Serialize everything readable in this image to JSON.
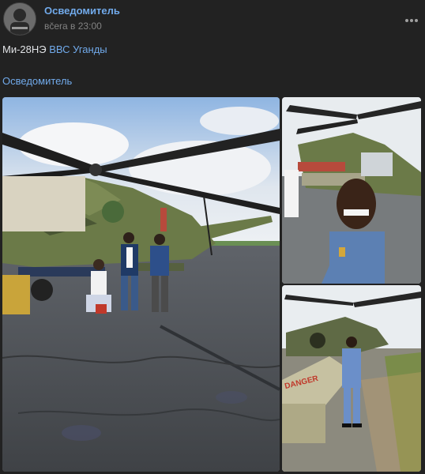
{
  "post": {
    "author": "Осведомитель",
    "time": "вčera в 23:00",
    "text_prefix": "Ми-28НЭ",
    "text_link": "ВВС Уганды",
    "signature": "Осведомитель"
  },
  "icons": {
    "avatar": "channel-avatar",
    "more": "more-dots-icon"
  },
  "photos": [
    {
      "name": "helicopter-group-photo"
    },
    {
      "name": "selfie-helicopter-photo"
    },
    {
      "name": "pilot-helicopter-photo",
      "label": "DANGER"
    }
  ],
  "colors": {
    "background": "#222222",
    "link": "#71aaeb",
    "text": "#e1e3e6",
    "muted": "#828282"
  }
}
